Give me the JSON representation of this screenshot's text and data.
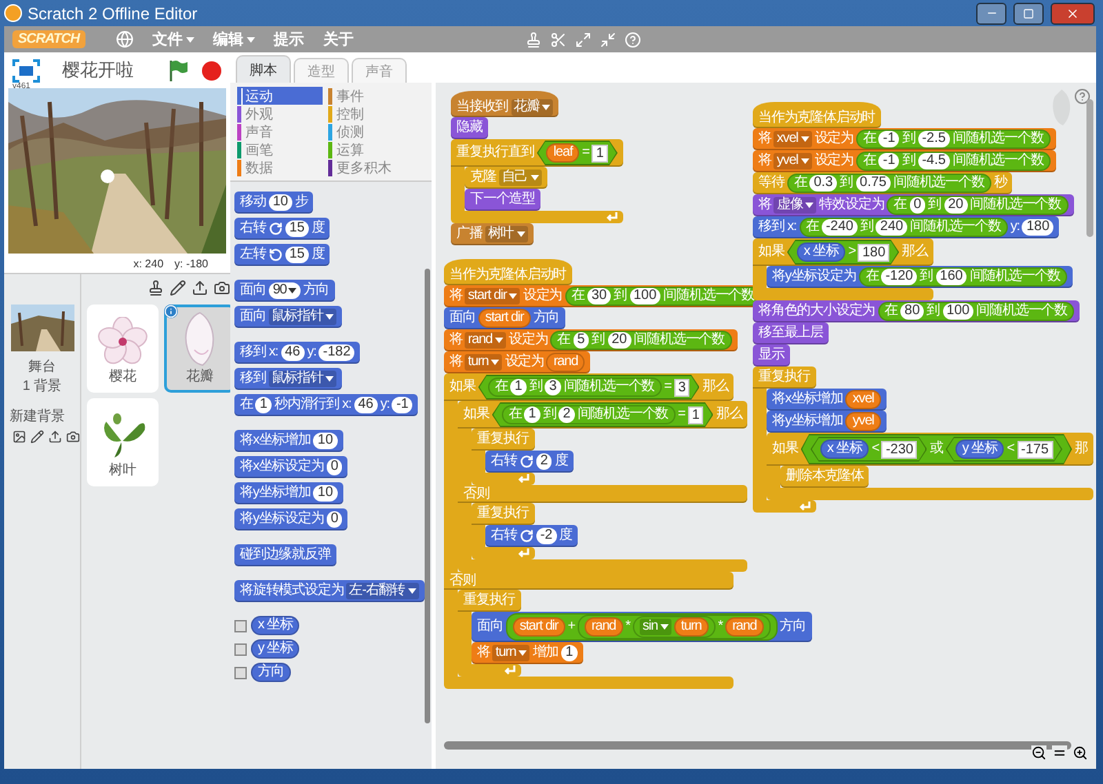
{
  "window": {
    "title": "Scratch 2 Offline Editor"
  },
  "menu_bar": {
    "logo": "SCRATCH",
    "menus": [
      {
        "label": "文件",
        "dropdown": true
      },
      {
        "label": "编辑",
        "dropdown": true
      },
      {
        "label": "提示",
        "dropdown": false
      },
      {
        "label": "关于",
        "dropdown": false
      }
    ]
  },
  "stage": {
    "title": "樱花开啦",
    "version": "v461",
    "x_reading": "x: 240",
    "y_reading": "y: -180"
  },
  "stage_tile": {
    "name": "舞台",
    "backdrops": "1 背景",
    "new_backdrop": "新建背景"
  },
  "sprites": [
    {
      "name": "樱花",
      "kind": "flower",
      "selected": false
    },
    {
      "name": "花瓣",
      "kind": "petal",
      "selected": true
    },
    {
      "name": "树叶",
      "kind": "leaf",
      "selected": false
    }
  ],
  "tabs": [
    {
      "label": "脚本",
      "selected": true
    },
    {
      "label": "造型",
      "selected": false
    },
    {
      "label": "声音",
      "selected": false
    }
  ],
  "categories": [
    {
      "label": "运动",
      "color": "#4a6cd4",
      "selected": true
    },
    {
      "label": "外观",
      "color": "#8a55d7",
      "selected": false
    },
    {
      "label": "声音",
      "color": "#bb42c3",
      "selected": false
    },
    {
      "label": "画笔",
      "color": "#0e9a6c",
      "selected": false
    },
    {
      "label": "数据",
      "color": "#ee7d16",
      "selected": false
    },
    {
      "label": "事件",
      "color": "#c88330",
      "selected": false
    },
    {
      "label": "控制",
      "color": "#e1a91a",
      "selected": false
    },
    {
      "label": "侦测",
      "color": "#2ca5e2",
      "selected": false
    },
    {
      "label": "运算",
      "color": "#5cb712",
      "selected": false
    },
    {
      "label": "更多积木",
      "color": "#632d99",
      "selected": false
    }
  ],
  "palette": {
    "groups": [
      [
        {
          "kind": "stack",
          "color": "#4a6cd4",
          "parts": [
            {
              "kind": "label",
              "text": "移动"
            },
            {
              "kind": "num",
              "text": "10"
            },
            {
              "kind": "label",
              "text": "步"
            }
          ]
        },
        {
          "kind": "stack",
          "color": "#4a6cd4",
          "parts": [
            {
              "kind": "label",
              "text": "右转"
            },
            {
              "kind": "rotate_cw"
            },
            {
              "kind": "num",
              "text": "15"
            },
            {
              "kind": "label",
              "text": "度"
            }
          ]
        },
        {
          "kind": "stack",
          "color": "#4a6cd4",
          "parts": [
            {
              "kind": "label",
              "text": "左转"
            },
            {
              "kind": "rotate_ccw"
            },
            {
              "kind": "num",
              "text": "15"
            },
            {
              "kind": "label",
              "text": "度"
            }
          ]
        }
      ],
      [
        {
          "kind": "stack",
          "color": "#4a6cd4",
          "parts": [
            {
              "kind": "label",
              "text": "面向"
            },
            {
              "kind": "round_menu",
              "text": "90"
            },
            {
              "kind": "label",
              "text": "方向"
            }
          ]
        },
        {
          "kind": "stack",
          "color": "#4a6cd4",
          "parts": [
            {
              "kind": "label",
              "text": "面向"
            },
            {
              "kind": "menu",
              "text": "鼠标指针"
            }
          ]
        }
      ],
      [
        {
          "kind": "stack",
          "color": "#4a6cd4",
          "parts": [
            {
              "kind": "label",
              "text": "移到 x:"
            },
            {
              "kind": "num",
              "text": "46"
            },
            {
              "kind": "label",
              "text": "y:"
            },
            {
              "kind": "num",
              "text": "-182"
            }
          ]
        },
        {
          "kind": "stack",
          "color": "#4a6cd4",
          "parts": [
            {
              "kind": "label",
              "text": "移到"
            },
            {
              "kind": "menu",
              "text": "鼠标指针"
            }
          ]
        },
        {
          "kind": "stack",
          "color": "#4a6cd4",
          "parts": [
            {
              "kind": "label",
              "text": "在"
            },
            {
              "kind": "num",
              "text": "1"
            },
            {
              "kind": "label",
              "text": "秒内滑行到 x:"
            },
            {
              "kind": "num",
              "text": "46"
            },
            {
              "kind": "label",
              "text": "y:"
            },
            {
              "kind": "num",
              "text": "-1"
            }
          ]
        }
      ],
      [
        {
          "kind": "stack",
          "color": "#4a6cd4",
          "parts": [
            {
              "kind": "label",
              "text": "将x坐标增加"
            },
            {
              "kind": "num",
              "text": "10"
            }
          ]
        },
        {
          "kind": "stack",
          "color": "#4a6cd4",
          "parts": [
            {
              "kind": "label",
              "text": "将x坐标设定为"
            },
            {
              "kind": "num",
              "text": "0"
            }
          ]
        },
        {
          "kind": "stack",
          "color": "#4a6cd4",
          "parts": [
            {
              "kind": "label",
              "text": "将y坐标增加"
            },
            {
              "kind": "num",
              "text": "10"
            }
          ]
        },
        {
          "kind": "stack",
          "color": "#4a6cd4",
          "parts": [
            {
              "kind": "label",
              "text": "将y坐标设定为"
            },
            {
              "kind": "num",
              "text": "0"
            }
          ]
        }
      ],
      [
        {
          "kind": "stack",
          "color": "#4a6cd4",
          "parts": [
            {
              "kind": "label",
              "text": "碰到边缘就反弹"
            }
          ]
        }
      ],
      [
        {
          "kind": "stack",
          "color": "#4a6cd4",
          "parts": [
            {
              "kind": "label",
              "text": "将旋转模式设定为"
            },
            {
              "kind": "menu",
              "text": "左-右翻转"
            }
          ]
        }
      ]
    ],
    "monitors": [
      {
        "label": "x 坐标",
        "checked": false
      },
      {
        "label": "y 坐标",
        "checked": false
      },
      {
        "label": "方向",
        "checked": false
      }
    ]
  },
  "scripts": [
    {
      "blocks": [
        {
          "kind": "hat",
          "color": "#c88330",
          "parts": [
            {
              "kind": "label",
              "text": "当接收到"
            },
            {
              "kind": "menu",
              "text": "花瓣"
            }
          ]
        },
        {
          "kind": "stack",
          "color": "#8a55d7",
          "parts": [
            {
              "kind": "label",
              "text": "隐藏"
            }
          ]
        },
        {
          "kind": "loop",
          "color": "#e1a91a",
          "parts": [
            {
              "kind": "label",
              "text": "重复执行直到"
            },
            {
              "kind": "bool",
              "color": "#5cb712",
              "parts": [
                {
                  "kind": "reporter",
                  "color": "#ee7d16",
                  "text": "leaf"
                },
                {
                  "kind": "label",
                  "text": "="
                },
                {
                  "kind": "text",
                  "text": "1"
                }
              ]
            }
          ],
          "children": [
            {
              "kind": "stack",
              "color": "#e1a91a",
              "parts": [
                {
                  "kind": "label",
                  "text": "克隆"
                },
                {
                  "kind": "menu",
                  "text": "自己"
                }
              ]
            },
            {
              "kind": "stack",
              "color": "#8a55d7",
              "parts": [
                {
                  "kind": "label",
                  "text": "下一个造型"
                }
              ]
            }
          ]
        },
        {
          "kind": "stack",
          "color": "#c88330",
          "parts": [
            {
              "kind": "label",
              "text": "广播"
            },
            {
              "kind": "menu",
              "text": "树叶"
            }
          ]
        }
      ]
    },
    {
      "blocks": [
        {
          "kind": "hat",
          "color": "#e1a91a",
          "parts": [
            {
              "kind": "label",
              "text": "当作为克隆体启动时"
            }
          ]
        },
        {
          "kind": "stack",
          "color": "#ee7d16",
          "parts": [
            {
              "kind": "label",
              "text": "将"
            },
            {
              "kind": "menu",
              "text": "start dir"
            },
            {
              "kind": "label",
              "text": "设定为"
            },
            {
              "kind": "reporter",
              "color": "#5cb712",
              "parts": [
                {
                  "kind": "label",
                  "text": "在"
                },
                {
                  "kind": "num",
                  "text": "30"
                },
                {
                  "kind": "label",
                  "text": "到"
                },
                {
                  "kind": "num",
                  "text": "100"
                },
                {
                  "kind": "label",
                  "text": "间随机选一个数"
                }
              ]
            }
          ]
        },
        {
          "kind": "stack",
          "color": "#4a6cd4",
          "parts": [
            {
              "kind": "label",
              "text": "面向"
            },
            {
              "kind": "reporter",
              "color": "#ee7d16",
              "text": "start dir"
            },
            {
              "kind": "label",
              "text": "方向"
            }
          ]
        },
        {
          "kind": "stack",
          "color": "#ee7d16",
          "parts": [
            {
              "kind": "label",
              "text": "将"
            },
            {
              "kind": "menu",
              "text": "rand"
            },
            {
              "kind": "label",
              "text": "设定为"
            },
            {
              "kind": "reporter",
              "color": "#5cb712",
              "parts": [
                {
                  "kind": "label",
                  "text": "在"
                },
                {
                  "kind": "num",
                  "text": "5"
                },
                {
                  "kind": "label",
                  "text": "到"
                },
                {
                  "kind": "num",
                  "text": "20"
                },
                {
                  "kind": "label",
                  "text": "间随机选一个数"
                }
              ]
            }
          ]
        },
        {
          "kind": "stack",
          "color": "#ee7d16",
          "parts": [
            {
              "kind": "label",
              "text": "将"
            },
            {
              "kind": "menu",
              "text": "turn"
            },
            {
              "kind": "label",
              "text": "设定为"
            },
            {
              "kind": "reporter",
              "color": "#ee7d16",
              "text": "rand"
            }
          ]
        },
        {
          "kind": "ifelse",
          "color": "#e1a91a",
          "else_label": "否则",
          "parts": [
            {
              "kind": "label",
              "text": "如果"
            },
            {
              "kind": "bool",
              "color": "#5cb712",
              "parts": [
                {
                  "kind": "reporter",
                  "color": "#5cb712",
                  "parts": [
                    {
                      "kind": "label",
                      "text": "在"
                    },
                    {
                      "kind": "num",
                      "text": "1"
                    },
                    {
                      "kind": "label",
                      "text": "到"
                    },
                    {
                      "kind": "num",
                      "text": "3"
                    },
                    {
                      "kind": "label",
                      "text": "间随机选一个数"
                    }
                  ]
                },
                {
                  "kind": "label",
                  "text": "="
                },
                {
                  "kind": "text",
                  "text": "3"
                }
              ]
            },
            {
              "kind": "label",
              "text": "那么"
            }
          ],
          "children": [
            {
              "kind": "ifelse",
              "color": "#e1a91a",
              "else_label": "否则",
              "parts": [
                {
                  "kind": "label",
                  "text": "如果"
                },
                {
                  "kind": "bool",
                  "color": "#5cb712",
                  "parts": [
                    {
                      "kind": "reporter",
                      "color": "#5cb712",
                      "parts": [
                        {
                          "kind": "label",
                          "text": "在"
                        },
                        {
                          "kind": "num",
                          "text": "1"
                        },
                        {
                          "kind": "label",
                          "text": "到"
                        },
                        {
                          "kind": "num",
                          "text": "2"
                        },
                        {
                          "kind": "label",
                          "text": "间随机选一个数"
                        }
                      ]
                    },
                    {
                      "kind": "label",
                      "text": "="
                    },
                    {
                      "kind": "text",
                      "text": "1"
                    }
                  ]
                },
                {
                  "kind": "label",
                  "text": "那么"
                }
              ],
              "children": [
                {
                  "kind": "loop",
                  "color": "#e1a91a",
                  "parts": [
                    {
                      "kind": "label",
                      "text": "重复执行"
                    }
                  ],
                  "children": [
                    {
                      "kind": "stack",
                      "color": "#4a6cd4",
                      "parts": [
                        {
                          "kind": "label",
                          "text": "右转"
                        },
                        {
                          "kind": "rotate_cw"
                        },
                        {
                          "kind": "num",
                          "text": "2"
                        },
                        {
                          "kind": "label",
                          "text": "度"
                        }
                      ]
                    }
                  ]
                }
              ],
              "else_children": [
                {
                  "kind": "loop",
                  "color": "#e1a91a",
                  "parts": [
                    {
                      "kind": "label",
                      "text": "重复执行"
                    }
                  ],
                  "children": [
                    {
                      "kind": "stack",
                      "color": "#4a6cd4",
                      "parts": [
                        {
                          "kind": "label",
                          "text": "右转"
                        },
                        {
                          "kind": "rotate_cw"
                        },
                        {
                          "kind": "num",
                          "text": "-2"
                        },
                        {
                          "kind": "label",
                          "text": "度"
                        }
                      ]
                    }
                  ]
                }
              ]
            }
          ],
          "else_children": [
            {
              "kind": "loop",
              "color": "#e1a91a",
              "parts": [
                {
                  "kind": "label",
                  "text": "重复执行"
                }
              ],
              "children": [
                {
                  "kind": "stack",
                  "color": "#4a6cd4",
                  "parts": [
                    {
                      "kind": "label",
                      "text": "面向"
                    },
                    {
                      "kind": "reporter",
                      "color": "#5cb712",
                      "parts": [
                        {
                          "kind": "reporter",
                          "color": "#ee7d16",
                          "text": "start dir"
                        },
                        {
                          "kind": "label",
                          "text": "+"
                        },
                        {
                          "kind": "reporter",
                          "color": "#5cb712",
                          "parts": [
                            {
                              "kind": "reporter",
                              "color": "#ee7d16",
                              "text": "rand"
                            },
                            {
                              "kind": "label",
                              "text": "*"
                            },
                            {
                              "kind": "reporter",
                              "color": "#5cb712",
                              "parts": [
                                {
                                  "kind": "menu",
                                  "text": "sin"
                                },
                                {
                                  "kind": "reporter",
                                  "color": "#ee7d16",
                                  "text": "turn"
                                }
                              ]
                            },
                            {
                              "kind": "label",
                              "text": "*"
                            },
                            {
                              "kind": "reporter",
                              "color": "#ee7d16",
                              "text": "rand"
                            }
                          ]
                        }
                      ]
                    },
                    {
                      "kind": "label",
                      "text": "方向"
                    }
                  ]
                },
                {
                  "kind": "stack",
                  "color": "#ee7d16",
                  "parts": [
                    {
                      "kind": "label",
                      "text": "将"
                    },
                    {
                      "kind": "menu",
                      "text": "turn"
                    },
                    {
                      "kind": "label",
                      "text": "增加"
                    },
                    {
                      "kind": "num",
                      "text": "1"
                    }
                  ]
                }
              ]
            }
          ]
        }
      ]
    },
    {
      "blocks": [
        {
          "kind": "hat",
          "color": "#e1a91a",
          "parts": [
            {
              "kind": "label",
              "text": "当作为克隆体启动时"
            }
          ]
        },
        {
          "kind": "stack",
          "color": "#ee7d16",
          "parts": [
            {
              "kind": "label",
              "text": "将"
            },
            {
              "kind": "menu",
              "text": "xvel"
            },
            {
              "kind": "label",
              "text": "设定为"
            },
            {
              "kind": "reporter",
              "color": "#5cb712",
              "parts": [
                {
                  "kind": "label",
                  "text": "在"
                },
                {
                  "kind": "num",
                  "text": "-1"
                },
                {
                  "kind": "label",
                  "text": "到"
                },
                {
                  "kind": "num",
                  "text": "-2.5"
                },
                {
                  "kind": "label",
                  "text": "间随机选一个数"
                }
              ]
            }
          ]
        },
        {
          "kind": "stack",
          "color": "#ee7d16",
          "parts": [
            {
              "kind": "label",
              "text": "将"
            },
            {
              "kind": "menu",
              "text": "yvel"
            },
            {
              "kind": "label",
              "text": "设定为"
            },
            {
              "kind": "reporter",
              "color": "#5cb712",
              "parts": [
                {
                  "kind": "label",
                  "text": "在"
                },
                {
                  "kind": "num",
                  "text": "-1"
                },
                {
                  "kind": "label",
                  "text": "到"
                },
                {
                  "kind": "num",
                  "text": "-4.5"
                },
                {
                  "kind": "label",
                  "text": "间随机选一个数"
                }
              ]
            }
          ]
        },
        {
          "kind": "stack",
          "color": "#e1a91a",
          "parts": [
            {
              "kind": "label",
              "text": "等待"
            },
            {
              "kind": "reporter",
              "color": "#5cb712",
              "parts": [
                {
                  "kind": "label",
                  "text": "在"
                },
                {
                  "kind": "num",
                  "text": "0.3"
                },
                {
                  "kind": "label",
                  "text": "到"
                },
                {
                  "kind": "num",
                  "text": "0.75"
                },
                {
                  "kind": "label",
                  "text": "间随机选一个数"
                }
              ]
            },
            {
              "kind": "label",
              "text": "秒"
            }
          ]
        },
        {
          "kind": "stack",
          "color": "#8a55d7",
          "parts": [
            {
              "kind": "label",
              "text": "将"
            },
            {
              "kind": "menu",
              "text": "虚像"
            },
            {
              "kind": "label",
              "text": "特效设定为"
            },
            {
              "kind": "reporter",
              "color": "#5cb712",
              "parts": [
                {
                  "kind": "label",
                  "text": "在"
                },
                {
                  "kind": "num",
                  "text": "0"
                },
                {
                  "kind": "label",
                  "text": "到"
                },
                {
                  "kind": "num",
                  "text": "20"
                },
                {
                  "kind": "label",
                  "text": "间随机选一个数"
                }
              ]
            }
          ]
        },
        {
          "kind": "stack",
          "color": "#4a6cd4",
          "parts": [
            {
              "kind": "label",
              "text": "移到 x:"
            },
            {
              "kind": "reporter",
              "color": "#5cb712",
              "parts": [
                {
                  "kind": "label",
                  "text": "在"
                },
                {
                  "kind": "num",
                  "text": "-240"
                },
                {
                  "kind": "label",
                  "text": "到"
                },
                {
                  "kind": "num",
                  "text": "240"
                },
                {
                  "kind": "label",
                  "text": "间随机选一个数"
                }
              ]
            },
            {
              "kind": "label",
              "text": "y:"
            },
            {
              "kind": "num",
              "text": "180"
            }
          ]
        },
        {
          "kind": "if",
          "color": "#e1a91a",
          "parts": [
            {
              "kind": "label",
              "text": "如果"
            },
            {
              "kind": "bool",
              "color": "#5cb712",
              "parts": [
                {
                  "kind": "reporter",
                  "color": "#4a6cd4",
                  "text": "x 坐标"
                },
                {
                  "kind": "label",
                  "text": ">"
                },
                {
                  "kind": "text",
                  "text": "180"
                }
              ]
            },
            {
              "kind": "label",
              "text": "那么"
            }
          ],
          "children": [
            {
              "kind": "stack",
              "color": "#4a6cd4",
              "parts": [
                {
                  "kind": "label",
                  "text": "将y坐标设定为"
                },
                {
                  "kind": "reporter",
                  "color": "#5cb712",
                  "parts": [
                    {
                      "kind": "label",
                      "text": "在"
                    },
                    {
                      "kind": "num",
                      "text": "-120"
                    },
                    {
                      "kind": "label",
                      "text": "到"
                    },
                    {
                      "kind": "num",
                      "text": "160"
                    },
                    {
                      "kind": "label",
                      "text": "间随机选一个数"
                    }
                  ]
                }
              ]
            }
          ]
        },
        {
          "kind": "stack",
          "color": "#8a55d7",
          "parts": [
            {
              "kind": "label",
              "text": "将角色的大小设定为"
            },
            {
              "kind": "reporter",
              "color": "#5cb712",
              "parts": [
                {
                  "kind": "label",
                  "text": "在"
                },
                {
                  "kind": "num",
                  "text": "80"
                },
                {
                  "kind": "label",
                  "text": "到"
                },
                {
                  "kind": "num",
                  "text": "100"
                },
                {
                  "kind": "label",
                  "text": "间随机选一个数"
                }
              ]
            }
          ]
        },
        {
          "kind": "stack",
          "color": "#8a55d7",
          "parts": [
            {
              "kind": "label",
              "text": "移至最上层"
            }
          ]
        },
        {
          "kind": "stack",
          "color": "#8a55d7",
          "parts": [
            {
              "kind": "label",
              "text": "显示"
            }
          ]
        },
        {
          "kind": "loop",
          "color": "#e1a91a",
          "parts": [
            {
              "kind": "label",
              "text": "重复执行"
            }
          ],
          "children": [
            {
              "kind": "stack",
              "color": "#4a6cd4",
              "parts": [
                {
                  "kind": "label",
                  "text": "将x坐标增加"
                },
                {
                  "kind": "reporter",
                  "color": "#ee7d16",
                  "text": "xvel"
                }
              ]
            },
            {
              "kind": "stack",
              "color": "#4a6cd4",
              "parts": [
                {
                  "kind": "label",
                  "text": "将y坐标增加"
                },
                {
                  "kind": "reporter",
                  "color": "#ee7d16",
                  "text": "yvel"
                }
              ]
            },
            {
              "kind": "if",
              "color": "#e1a91a",
              "parts": [
                {
                  "kind": "label",
                  "text": "如果"
                },
                {
                  "kind": "bool",
                  "color": "#5cb712",
                  "parts": [
                    {
                      "kind": "bool",
                      "color": "#5cb712",
                      "parts": [
                        {
                          "kind": "reporter",
                          "color": "#4a6cd4",
                          "text": "x 坐标"
                        },
                        {
                          "kind": "label",
                          "text": "<"
                        },
                        {
                          "kind": "text",
                          "text": "-230"
                        }
                      ]
                    },
                    {
                      "kind": "label",
                      "text": "或"
                    },
                    {
                      "kind": "bool",
                      "color": "#5cb712",
                      "parts": [
                        {
                          "kind": "reporter",
                          "color": "#4a6cd4",
                          "text": "y 坐标"
                        },
                        {
                          "kind": "label",
                          "text": "<"
                        },
                        {
                          "kind": "text",
                          "text": "-175"
                        }
                      ]
                    }
                  ]
                },
                {
                  "kind": "label",
                  "text": "那"
                }
              ],
              "children": [
                {
                  "kind": "stack",
                  "color": "#e1a91a",
                  "parts": [
                    {
                      "kind": "label",
                      "text": "删除本克隆体"
                    }
                  ]
                }
              ]
            }
          ]
        }
      ]
    }
  ]
}
